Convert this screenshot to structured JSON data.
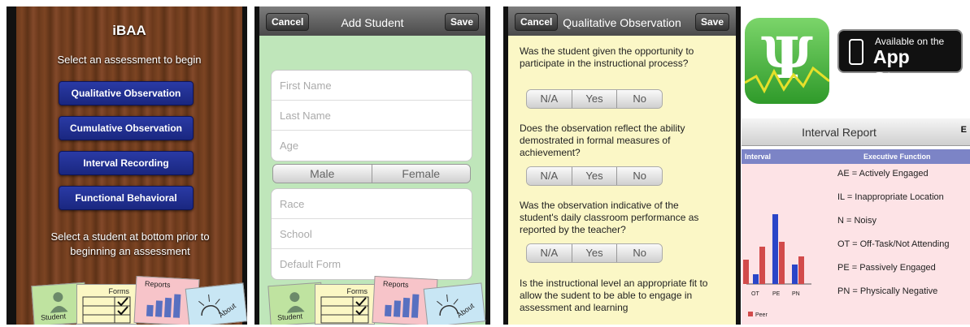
{
  "panel1": {
    "title": "iBAA",
    "subtitle": "Select an assessment to begin",
    "buttons": [
      "Qualitative Observation",
      "Cumulative Observation",
      "Interval Recording",
      "Functional Behavioral"
    ],
    "footer": "Select a student at bottom prior to beginning an assessment",
    "tabs": {
      "student": "Student",
      "forms": "Forms",
      "reports": "Reports",
      "about": "About"
    }
  },
  "panel2": {
    "cancel": "Cancel",
    "title": "Add Student",
    "save": "Save",
    "fields_top": [
      "First Name",
      "Last Name",
      "Age"
    ],
    "gender": [
      "Male",
      "Female"
    ],
    "fields_bottom": [
      "Race",
      "School",
      "Default Form"
    ],
    "tabs": {
      "student": "Student",
      "forms": "Forms",
      "reports": "Reports",
      "about": "About"
    }
  },
  "panel3": {
    "cancel": "Cancel",
    "title": "Qualitative Observation",
    "save": "Save",
    "questions": [
      "Was the student given the opportunity to participate in the instructional process?",
      "Does the observation reflect the ability demostrated in formal measures of achievement?",
      "Was the observation indicative of the student's daily classroom performance as reported by the teacher?",
      "Is the instructional level an appropriate fit to allow the sudent to be able to engage in assessment and learning"
    ],
    "choices": [
      "N/A",
      "Yes",
      "No"
    ]
  },
  "panel4": {
    "appstore_small": "Available on the",
    "appstore_big": "App Store",
    "report_title": "Interval Report",
    "report_cut": "E",
    "head_interval": "Interval",
    "head_exec": "Executive Function",
    "legend": [
      "AE = Actively Engaged",
      "IL = Inappropriate Location",
      "N = Noisy",
      "OT = Off-Task/Not Attending",
      "PE = Passively Engaged",
      "PN = Physically Negative"
    ],
    "chart_cats": [
      "OT",
      "PE",
      "PN"
    ],
    "chart_legend": "Peer",
    "colors": {
      "student": "#2a45c8",
      "peer": "#d24b4b"
    }
  }
}
